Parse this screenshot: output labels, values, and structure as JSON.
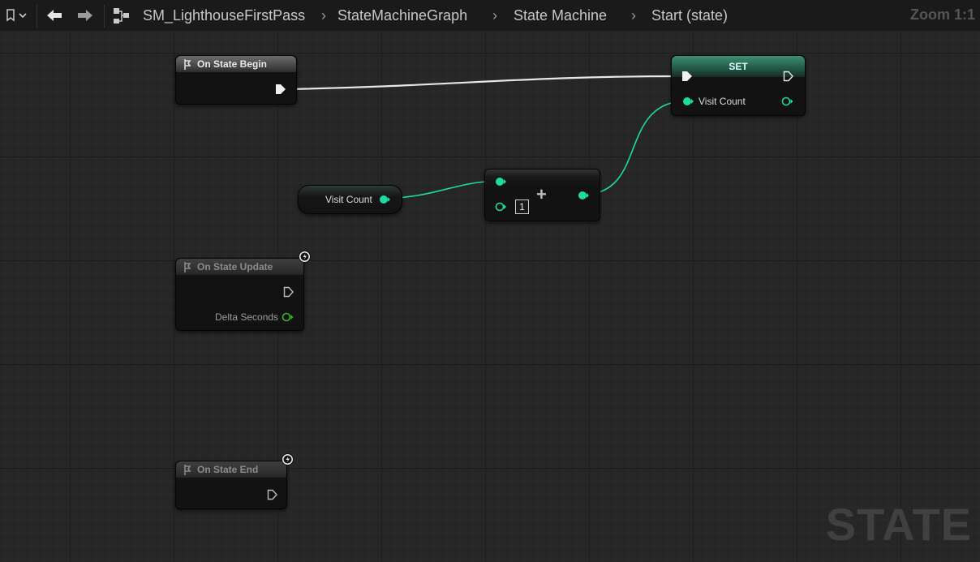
{
  "toolbar": {
    "bookmark_icon": "bookmark-icon",
    "back_icon": "arrow-left-icon",
    "forward_icon": "arrow-right-icon",
    "tree_icon": "hierarchy-icon"
  },
  "breadcrumb": [
    "SM_LighthouseFirstPass",
    "StateMachineGraph",
    "State Machine",
    "Start (state)"
  ],
  "zoom_label": "Zoom 1:1",
  "watermark": "STATE",
  "nodes": {
    "on_state_begin": {
      "title": "On State Begin"
    },
    "set": {
      "title": "SET",
      "input_label": "Visit Count"
    },
    "get_visit_count": {
      "label": "Visit Count"
    },
    "add": {
      "symbol": "+",
      "b_value": "1"
    },
    "on_state_update": {
      "title": "On State Update",
      "output_label": "Delta Seconds"
    },
    "on_state_end": {
      "title": "On State End"
    }
  },
  "colors": {
    "exec_wire": "#e6e6e6",
    "int_pin": "#1edba3",
    "float_pin": "#3ab52b",
    "grid_bg": "#262626"
  }
}
